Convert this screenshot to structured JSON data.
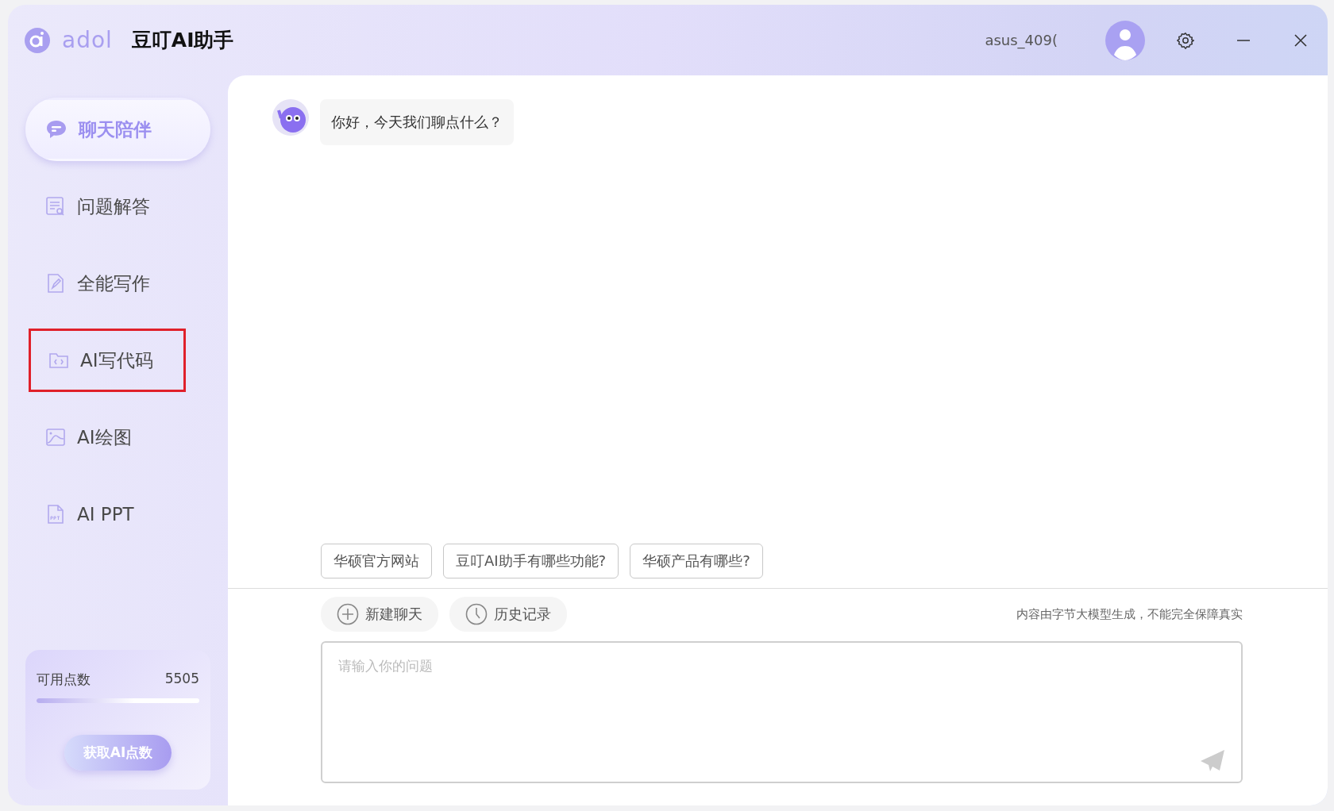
{
  "header": {
    "logo": "adol",
    "title": "豆叮AI助手",
    "username": "asus_409("
  },
  "sidebar": {
    "items": [
      {
        "label": "聊天陪伴",
        "selected": true,
        "highlighted": false
      },
      {
        "label": "问题解答",
        "selected": false,
        "highlighted": false
      },
      {
        "label": "全能写作",
        "selected": false,
        "highlighted": false
      },
      {
        "label": "AI写代码",
        "selected": false,
        "highlighted": true
      },
      {
        "label": "AI绘图",
        "selected": false,
        "highlighted": false
      },
      {
        "label": "AI PPT",
        "selected": false,
        "highlighted": false
      }
    ],
    "points": {
      "label": "可用点数",
      "value": "5505",
      "level": 0.6,
      "button": "获取AI点数"
    }
  },
  "chat": {
    "messages": [
      {
        "text": "你好，今天我们聊点什么？"
      }
    ],
    "suggestions": [
      "华硕官方网站",
      "豆叮AI助手有哪些功能?",
      "华硕产品有哪些?"
    ],
    "actions": [
      "新建聊天",
      "历史记录"
    ],
    "disclaimer": "内容由字节大模型生成，不能完全保障真实",
    "input": {
      "placeholder": "请输入你的问题"
    }
  }
}
